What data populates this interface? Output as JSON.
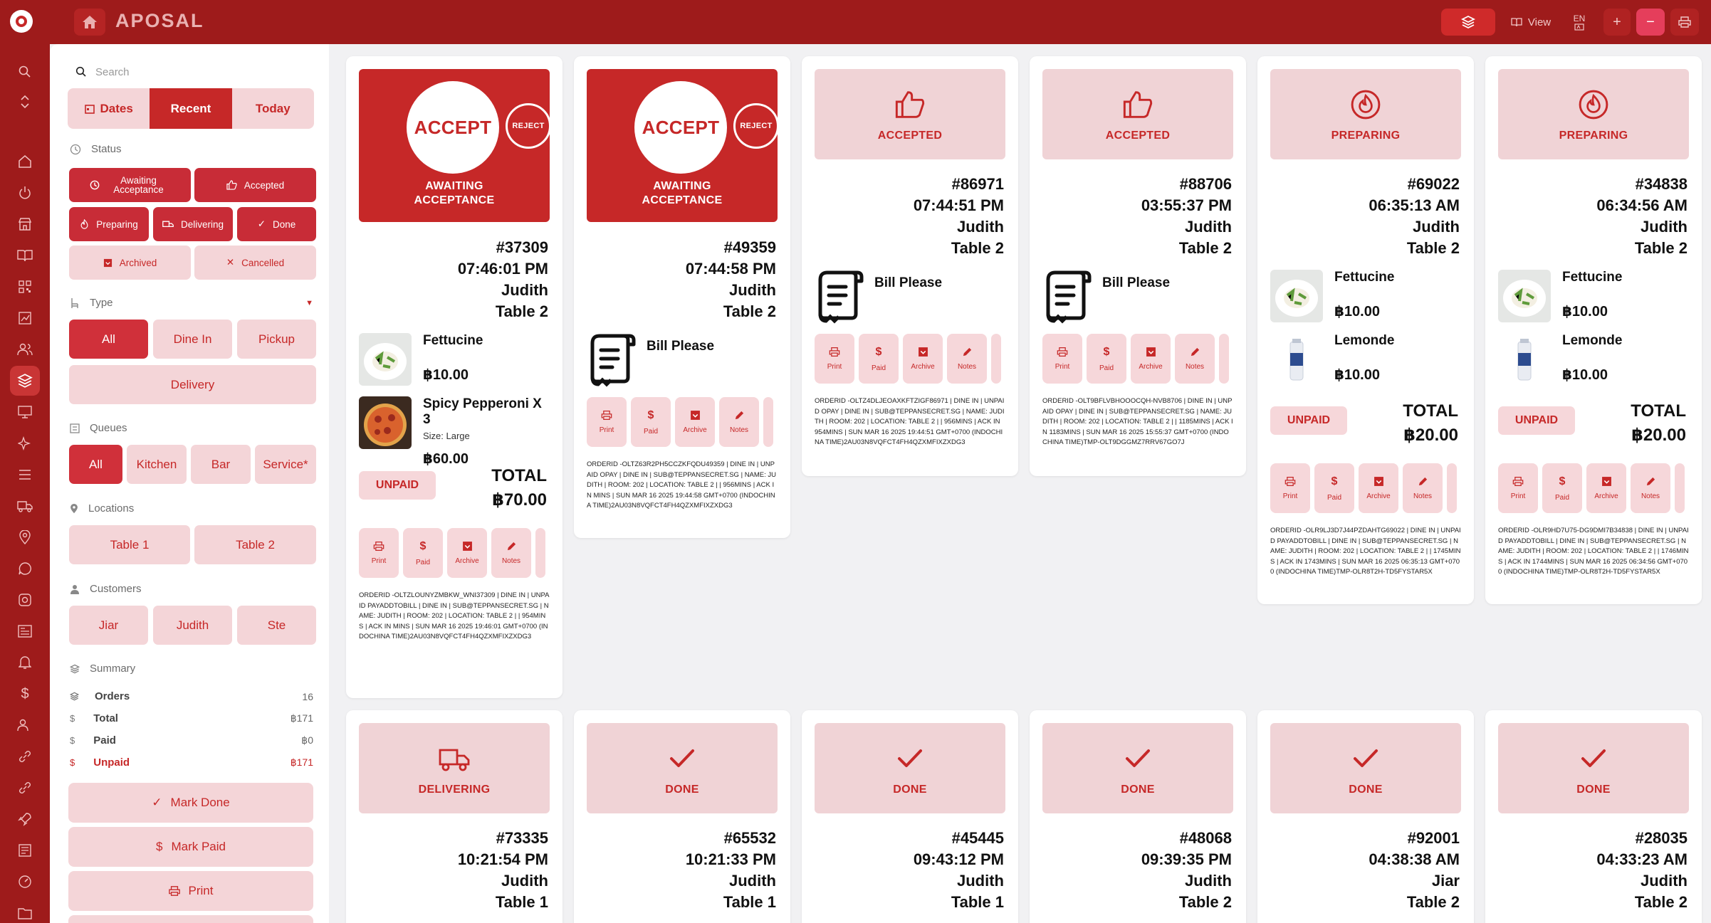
{
  "app": {
    "title": "APOSAL"
  },
  "topbar": {
    "view_label": "View",
    "lang_label": "EN"
  },
  "search": {
    "placeholder": "Search"
  },
  "time_tabs": [
    "Dates",
    "Recent",
    "Today"
  ],
  "sections": {
    "status": "Status",
    "type": "Type",
    "queues": "Queues",
    "locations": "Locations",
    "customers": "Customers",
    "summary": "Summary"
  },
  "status_filters": [
    "Awaiting Acceptance",
    "Accepted",
    "Preparing",
    "Delivering",
    "Done",
    "Archived",
    "Cancelled"
  ],
  "type_filters": [
    "All",
    "Dine In",
    "Pickup",
    "Delivery"
  ],
  "queue_filters": [
    "All",
    "Kitchen",
    "Bar",
    "Service*"
  ],
  "location_filters": [
    "Table 1",
    "Table 2"
  ],
  "customer_filters": [
    "Jiar",
    "Judith",
    "Ste"
  ],
  "summary": {
    "orders_label": "Orders",
    "orders_value": "16",
    "total_label": "Total",
    "total_value": "฿171",
    "paid_label": "Paid",
    "paid_value": "฿0",
    "unpaid_label": "Unpaid",
    "unpaid_value": "฿171"
  },
  "actions": {
    "mark_done": "Mark Done",
    "mark_paid": "Mark Paid",
    "print": "Print"
  },
  "card_actions": [
    "Print",
    "Paid",
    "Archive",
    "Notes"
  ],
  "orders": [
    {
      "accept": "ACCEPT",
      "reject": "REJECT",
      "status_line1": "AWAITING",
      "status_line2": "ACCEPTANCE",
      "id": "#37309",
      "time": "07:46:01 PM",
      "customer": "Judith",
      "table": "Table 2",
      "items": [
        {
          "name": "Fettucine",
          "price": "฿10.00"
        },
        {
          "name": "Spicy Pepperoni X 3",
          "size": "Size: Large",
          "price": "฿60.00"
        }
      ],
      "payment": "UNPAID",
      "total_label": "TOTAL",
      "total": "฿70.00",
      "meta": "ORDERID -OLTZLOUNYZMBKW_WNI37309 | DINE IN | UNPAID PAYADDTOBILL | DINE IN | SUB@TEPPANSECRET.SG | NAME: JUDITH | ROOM: 202 | LOCATION: TABLE 2 | | 954MINS | ACK IN MINS | SUN MAR 16 2025 19:46:01 GMT+0700 (INDOCHINA TIME)2AU03N8VQFCT4FH4QZXMFIXZXDG3"
    },
    {
      "accept": "ACCEPT",
      "reject": "REJECT",
      "status_line1": "AWAITING",
      "status_line2": "ACCEPTANCE",
      "id": "#49359",
      "time": "07:44:58 PM",
      "customer": "Judith",
      "table": "Table 2",
      "bill": "Bill Please",
      "meta": "ORDERID -OLTZ63R2PH5CCZKFQDU49359 | DINE IN | UNPAID OPAY | DINE IN | SUB@TEPPANSECRET.SG | NAME: JUDITH | ROOM: 202 | LOCATION: TABLE 2 | | 956MINS | ACK IN MINS | SUN MAR 16 2025 19:44:58 GMT+0700 (INDOCHINA TIME)2AU03N8VQFCT4FH4QZXMFIXZXDG3"
    },
    {
      "status": "ACCEPTED",
      "id": "#86971",
      "time": "07:44:51 PM",
      "customer": "Judith",
      "table": "Table 2",
      "bill": "Bill Please",
      "meta": "ORDERID -OLTZ4DLJEOAXKFTZIGF86971 | DINE IN | UNPAID OPAY | DINE IN | SUB@TEPPANSECRET.SG | NAME: JUDITH | ROOM: 202 | LOCATION: TABLE 2 | | 956MINS | ACK IN 954MINS | SUN MAR 16 2025 19:44:51 GMT+0700 (INDOCHINA TIME)2AU03N8VQFCT4FH4QZXMFIXZXDG3"
    },
    {
      "status": "ACCEPTED",
      "id": "#88706",
      "time": "03:55:37 PM",
      "customer": "Judith",
      "table": "Table 2",
      "bill": "Bill Please",
      "meta": "ORDERID -OLT9BFLVBHOOOCQH-NVB8706 | DINE IN | UNPAID OPAY | DINE IN | SUB@TEPPANSECRET.SG | NAME: JUDITH | ROOM: 202 | LOCATION: TABLE 2 | | 1185MINS | ACK IN 1183MINS | SUN MAR 16 2025 15:55:37 GMT+0700 (INDOCHINA TIME)TMP-OLT9DGGMZ7RRV67GO7J"
    },
    {
      "status": "PREPARING",
      "id": "#69022",
      "time": "06:35:13 AM",
      "customer": "Judith",
      "table": "Table 2",
      "items": [
        {
          "name": "Fettucine",
          "price": "฿10.00"
        },
        {
          "name": "Lemonde",
          "price": "฿10.00"
        }
      ],
      "payment": "UNPAID",
      "total_label": "TOTAL",
      "total": "฿20.00",
      "meta": "ORDERID -OLR9LJ3D7J44PZDAHTG69022 | DINE IN | UNPAID PAYADDTOBILL | DINE IN | SUB@TEPPANSECRET.SG | NAME: JUDITH | ROOM: 202 | LOCATION: TABLE 2 | | 1745MINS | ACK IN 1743MINS | SUN MAR 16 2025 06:35:13 GMT+0700 (INDOCHINA TIME)TMP-OLR8T2H-TD5FYSTAR5X"
    },
    {
      "status": "PREPARING",
      "id": "#34838",
      "time": "06:34:56 AM",
      "customer": "Judith",
      "table": "Table 2",
      "items": [
        {
          "name": "Fettucine",
          "price": "฿10.00"
        },
        {
          "name": "Lemonde",
          "price": "฿10.00"
        }
      ],
      "payment": "UNPAID",
      "total_label": "TOTAL",
      "total": "฿20.00",
      "meta": "ORDERID -OLR9HD7U75-DG9DMI7B34838 | DINE IN | UNPAID PAYADDTOBILL | DINE IN | SUB@TEPPANSECRET.SG | NAME: JUDITH | ROOM: 202 | LOCATION: TABLE 2 | | 1746MINS | ACK IN 1744MINS | SUN MAR 16 2025 06:34:56 GMT+0700 (INDOCHINA TIME)TMP-OLR8T2H-TD5FYSTAR5X"
    },
    {
      "status": "DELIVERING",
      "id": "#73335",
      "time": "10:21:54 PM",
      "customer": "Judith",
      "table": "Table 1"
    },
    {
      "status": "DONE",
      "id": "#65532",
      "time": "10:21:33 PM",
      "customer": "Judith",
      "table": "Table 1"
    },
    {
      "status": "DONE",
      "id": "#45445",
      "time": "09:43:12 PM",
      "customer": "Judith",
      "table": "Table 1"
    },
    {
      "status": "DONE",
      "id": "#48068",
      "time": "09:39:35 PM",
      "customer": "Judith",
      "table": "Table 2"
    },
    {
      "status": "DONE",
      "id": "#92001",
      "time": "04:38:38 AM",
      "customer": "Jiar",
      "table": "Table 2"
    },
    {
      "status": "DONE",
      "id": "#28035",
      "time": "04:33:23 AM",
      "customer": "Judith",
      "table": "Table 2"
    }
  ],
  "colors": {
    "brand_dark": "#9e1b1b",
    "brand": "#c62828",
    "pill": "#f4d5d8"
  }
}
